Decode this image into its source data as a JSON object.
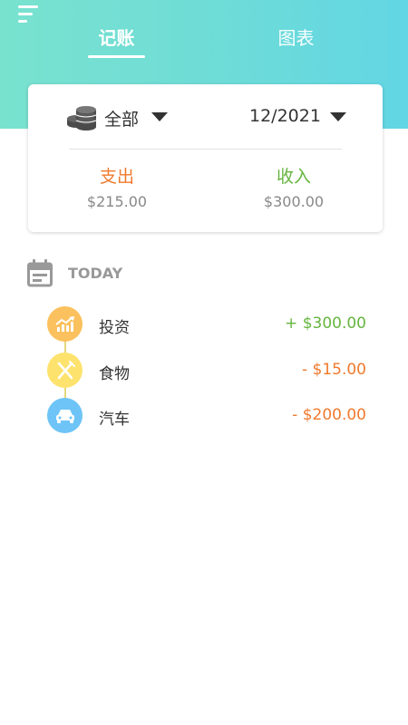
{
  "header": {
    "tabs": [
      {
        "label": "记账",
        "active": true
      },
      {
        "label": "图表",
        "active": false
      }
    ],
    "menu_icon": "menu-icon"
  },
  "summary_card": {
    "account_filter": "全部",
    "account_icon": "coins-icon",
    "date_filter": "12/2021",
    "expense": {
      "label": "支出",
      "amount": "$215.00"
    },
    "income": {
      "label": "收入",
      "amount": "$300.00"
    }
  },
  "day_group": {
    "label": "TODAY",
    "icon": "calendar-icon",
    "transactions": [
      {
        "name": "投资",
        "amount": "+ $300.00",
        "icon": "investment-chart-icon",
        "color": "#fbc15e",
        "type": "income"
      },
      {
        "name": "食物",
        "amount": "- $15.00",
        "icon": "fork-knife-icon",
        "color": "#fde36e",
        "type": "expense"
      },
      {
        "name": "汽车",
        "amount": "- $200.00",
        "icon": "car-icon",
        "color": "#6ec4f6",
        "type": "expense"
      }
    ]
  },
  "colors": {
    "header_start": "#79e2cf",
    "header_end": "#62d6e4",
    "expense": "#f07a2e",
    "income": "#66b53f"
  }
}
